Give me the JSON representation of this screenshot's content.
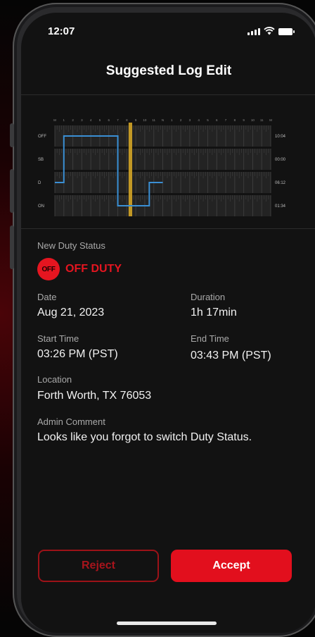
{
  "status_bar": {
    "time": "12:07"
  },
  "header": {
    "title": "Suggested Log Edit"
  },
  "chart_data": {
    "type": "line",
    "y_categories": [
      "OFF",
      "SB",
      "D",
      "ON"
    ],
    "right_totals": [
      "10:04",
      "00:00",
      "06:12",
      "01:34"
    ],
    "x_hours": [
      "M",
      "1",
      "2",
      "3",
      "4",
      "5",
      "6",
      "7",
      "8",
      "9",
      "10",
      "11",
      "N",
      "1",
      "2",
      "3",
      "4",
      "5",
      "6",
      "7",
      "8",
      "9",
      "10",
      "11",
      "M"
    ],
    "series": [
      {
        "x": [
          0,
          1,
          1,
          7,
          7,
          10.5,
          10.5,
          12
        ],
        "y": [
          "D",
          "D",
          "OFF",
          "OFF",
          "ON",
          "ON",
          "D",
          "D"
        ]
      }
    ],
    "highlight": {
      "start": 8.2,
      "end": 8.6
    },
    "colors": {
      "line": "#3a8fd4",
      "highlight": "#d4a526"
    }
  },
  "details": {
    "duty_status_label": "New Duty Status",
    "duty_badge": "OFF",
    "duty_status_value": "OFF DUTY",
    "date_label": "Date",
    "date_value": "Aug 21, 2023",
    "duration_label": "Duration",
    "duration_value": "1h 17min",
    "start_label": "Start Time",
    "start_value": "03:26 PM (PST)",
    "end_label": "End Time",
    "end_value": "03:43 PM (PST)",
    "location_label": "Location",
    "location_value": "Forth Worth, TX 76053",
    "comment_label": "Admin Comment",
    "comment_value": "Looks like you forgot to switch Duty Status."
  },
  "actions": {
    "reject_label": "Reject",
    "accept_label": "Accept"
  },
  "colors": {
    "accent": "#e51520",
    "background": "#121212"
  }
}
